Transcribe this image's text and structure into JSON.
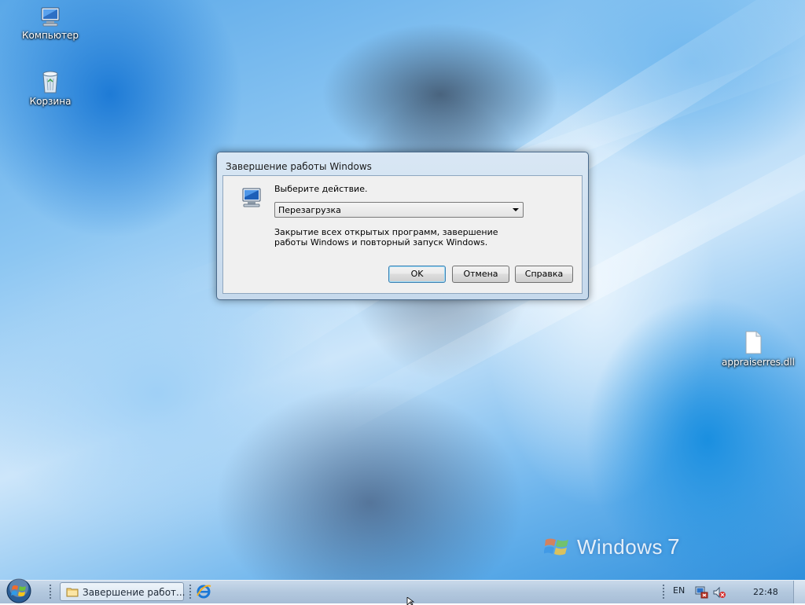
{
  "desktop": {
    "icons": [
      {
        "label": "Компьютер",
        "icon": "computer-icon"
      },
      {
        "label": "Корзина",
        "icon": "recycle-bin-icon"
      },
      {
        "label": "appraiserres.dll",
        "icon": "file-icon"
      }
    ],
    "watermark": {
      "text": "Windows",
      "version": "7"
    }
  },
  "dialog": {
    "title": "Завершение работы Windows",
    "prompt": "Выберите действие.",
    "selected_action": "Перезагрузка",
    "description": "Закрытие всех открытых программ, завершение работы Windows и повторный запуск Windows.",
    "buttons": {
      "ok": "OK",
      "cancel": "Отмена",
      "help": "Справка"
    }
  },
  "taskbar": {
    "task_label": "Завершение работ...",
    "language": "EN",
    "clock": "22:48"
  },
  "colors": {
    "taskbar": "#b3c8de",
    "dialog_frame": "#c6d9ec",
    "dialog_body": "#f0f0f0"
  }
}
